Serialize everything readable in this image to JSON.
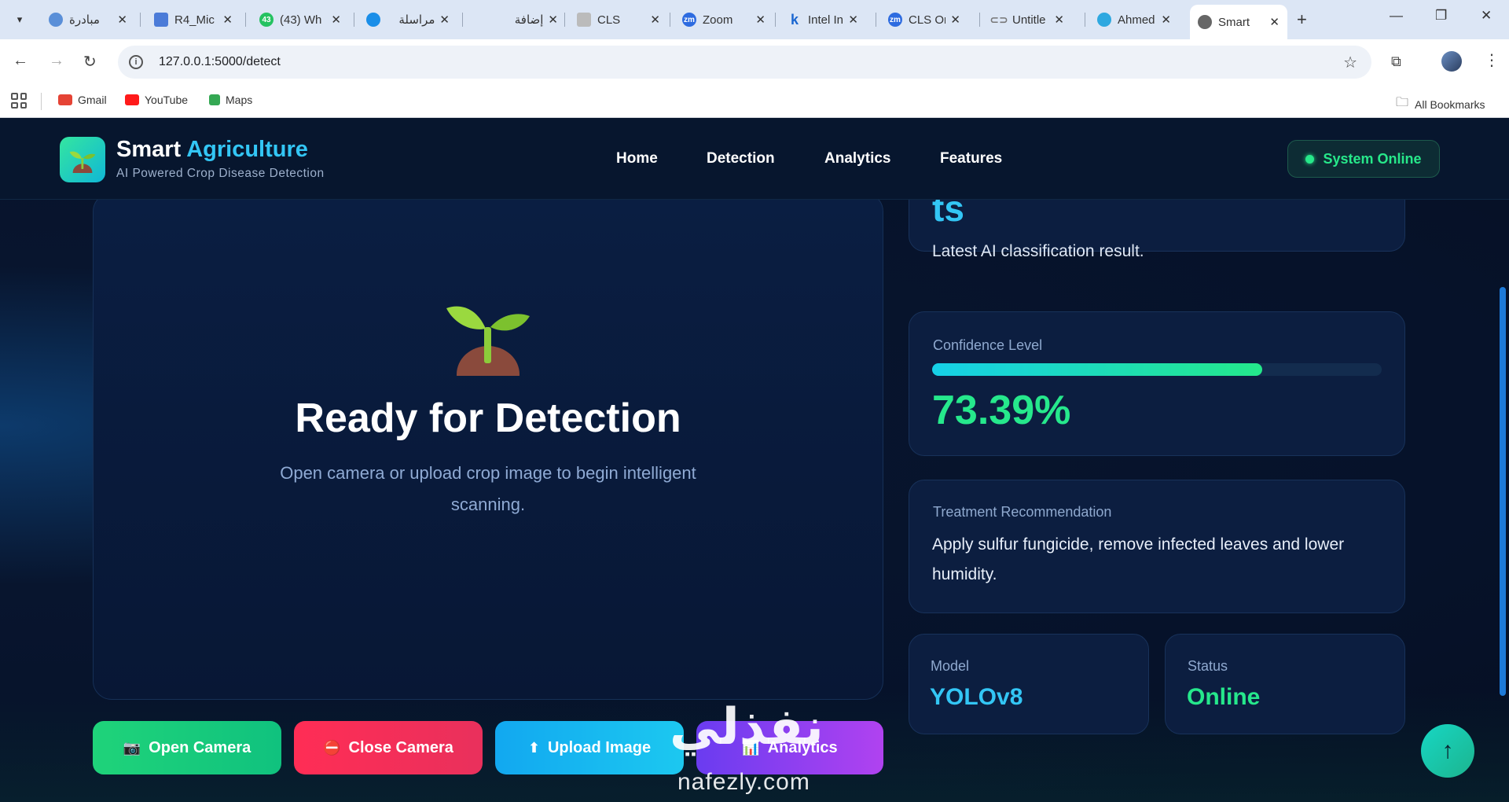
{
  "browser": {
    "tabs": [
      {
        "label": "مبادرة",
        "color": "#5a8fd8"
      },
      {
        "label": "R4_Mic",
        "color": "#4b7bd8"
      },
      {
        "label": "(43) Wh",
        "color": "#25c261"
      },
      {
        "label": "مراسلة",
        "color": "#1a8ee8"
      },
      {
        "label": "إضافة",
        "color": "#cccccc"
      },
      {
        "label": "CLS",
        "color": "#888888"
      },
      {
        "label": "Zoom",
        "color": "#2d6be0"
      },
      {
        "label": "Intel In",
        "color": "#1a66d0"
      },
      {
        "label": "CLS Or",
        "color": "#2d6be0"
      },
      {
        "label": "Untitle",
        "color": "#777777"
      },
      {
        "label": "Ahmed",
        "color": "#2ea8e0"
      },
      {
        "label": "Smart",
        "color": "#666666"
      }
    ],
    "url": "127.0.0.1:5000/detect",
    "bookmarks": [
      {
        "label": "Gmail",
        "color": "#e54335"
      },
      {
        "label": "YouTube",
        "color": "#ff1a1a"
      },
      {
        "label": "Maps",
        "color": "#34a853"
      }
    ],
    "all_bookmarks": "All Bookmarks"
  },
  "header": {
    "brand_main": "Smart",
    "brand_accent": "Agriculture",
    "tagline": "AI Powered Crop Disease Detection",
    "nav": [
      "Home",
      "Detection",
      "Analytics",
      "Features"
    ],
    "status": "System Online"
  },
  "detection_panel": {
    "title": "Ready for Detection",
    "subtitle": "Open camera or upload crop image to begin intelligent scanning."
  },
  "result_card": {
    "result_fragment": "ts",
    "subtitle": "Latest AI classification result."
  },
  "confidence_card": {
    "label": "Confidence Level",
    "value": "73.39%",
    "fraction": 0.7339
  },
  "treatment_card": {
    "label": "Treatment Recommendation",
    "text": "Apply sulfur fungicide, remove infected leaves and lower humidity."
  },
  "model_card": {
    "label": "Model",
    "value": "YOLOv8"
  },
  "status_card": {
    "label": "Status",
    "value": "Online"
  },
  "buttons": [
    {
      "label": "Open Camera",
      "icon": "camera-icon"
    },
    {
      "label": "Close Camera",
      "icon": "stop-icon"
    },
    {
      "label": "Upload Image",
      "icon": "upload-arrow-icon"
    },
    {
      "label": "Analytics",
      "icon": "chart-icon"
    }
  ],
  "watermark": {
    "arabic": "نفذلي",
    "url": "nafezly.com"
  },
  "colors": {
    "accent_cyan": "#33c6f5",
    "accent_green": "#26e88c",
    "open_camera": "#1fd37a",
    "close_camera": "#f2305c",
    "upload": "#12a8f0",
    "analytics": "#8c3cf0"
  }
}
